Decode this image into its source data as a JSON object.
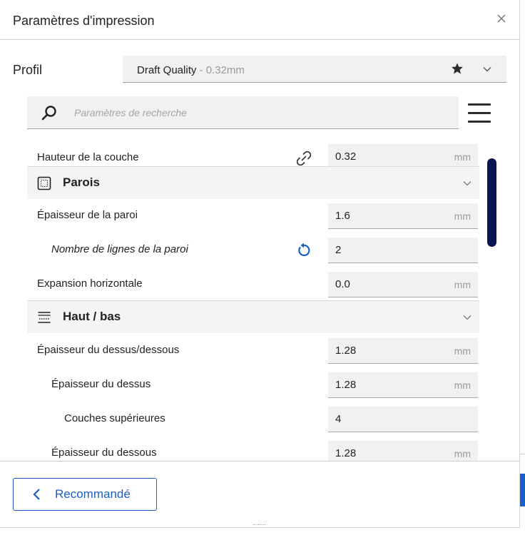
{
  "dialog": {
    "title": "Paramètres d'impression"
  },
  "profile": {
    "label": "Profil",
    "name": "Draft Quality",
    "suffix": " - 0.32mm"
  },
  "search": {
    "placeholder": "Paramètres de recherche",
    "value": ""
  },
  "settings": {
    "layer_height": {
      "label": "Hauteur de la couche",
      "value": "0.32",
      "unit": "mm"
    },
    "walls": {
      "title": "Parois",
      "thickness": {
        "label": "Épaisseur de la paroi",
        "value": "1.6",
        "unit": "mm"
      },
      "line_count": {
        "label": "Nombre de lignes de la paroi",
        "value": "2"
      },
      "horizontal_expansion": {
        "label": "Expansion horizontale",
        "value": "0.0",
        "unit": "mm"
      }
    },
    "top_bottom": {
      "title": "Haut / bas",
      "thickness": {
        "label": "Épaisseur du dessus/dessous",
        "value": "1.28",
        "unit": "mm"
      },
      "top_thickness": {
        "label": "Épaisseur du dessus",
        "value": "1.28",
        "unit": "mm"
      },
      "top_layers": {
        "label": "Couches supérieures",
        "value": "4"
      },
      "bottom_thickness": {
        "label": "Épaisseur du dessous",
        "value": "1.28",
        "unit": "mm"
      }
    }
  },
  "footer": {
    "recommended_label": "Recommandé"
  },
  "colors": {
    "accent": "#1a5fc7",
    "scrollbar": "#0b1453"
  }
}
